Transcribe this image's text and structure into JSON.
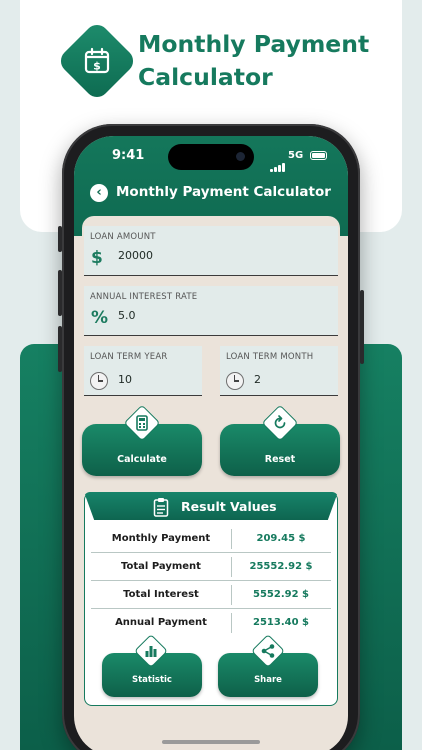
{
  "promo": {
    "headline_line1": "Monthly Payment",
    "headline_line2": "Calculator",
    "logo_icon": "calendar-dollar-icon"
  },
  "status_bar": {
    "time": "9:41",
    "network": "5G"
  },
  "app_bar": {
    "title": "Monthly Payment Calculator",
    "back_icon": "chevron-left-icon"
  },
  "form": {
    "loan_amount": {
      "label": "LOAN AMOUNT",
      "icon": "$",
      "value": "20000"
    },
    "interest_rate": {
      "label": "ANNUAL INTEREST RATE",
      "icon": "%",
      "value": "5.0"
    },
    "term_year": {
      "label": "LOAN TERM YEAR",
      "value": "10"
    },
    "term_month": {
      "label": "LOAN TERM MONTH",
      "value": "2"
    }
  },
  "actions": {
    "calculate_label": "Calculate",
    "reset_label": "Reset"
  },
  "results": {
    "title": "Result Values",
    "rows": [
      {
        "label": "Monthly Payment",
        "value": "209.45 $"
      },
      {
        "label": "Total Payment",
        "value": "25552.92 $"
      },
      {
        "label": "Total Interest",
        "value": "5552.92 $"
      },
      {
        "label": "Annual Payment",
        "value": "2513.40 $"
      }
    ],
    "statistic_label": "Statistic",
    "share_label": "Share"
  },
  "colors": {
    "brand_green": "#167a5e",
    "header_green": "#0f6a51",
    "field_bg": "#e2ebea",
    "screen_bg": "#ebe3da"
  }
}
